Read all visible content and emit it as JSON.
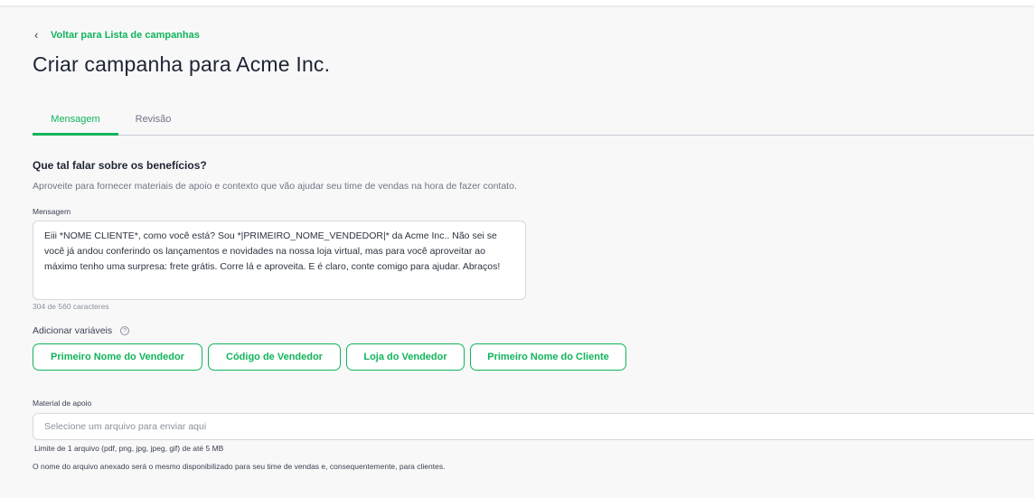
{
  "header": {
    "back_icon": "chevron-left-icon",
    "back_label": "Voltar para Lista de campanhas",
    "title": "Criar campanha para Acme Inc."
  },
  "tabs": [
    {
      "label": "Mensagem",
      "active": true
    },
    {
      "label": "Revisão",
      "active": false
    }
  ],
  "section": {
    "title": "Que tal falar sobre os benefícios?",
    "subtitle": "Aproveite para fornecer materiais de apoio e contexto que vão ajudar seu time de vendas na hora de fazer contato."
  },
  "message": {
    "label": "Mensagem",
    "value": "Eiii *NOME CLIENTE*, como você está? Sou *|PRIMEIRO_NOME_VENDEDOR|* da Acme Inc.. Não sei se você já andou conferindo os lançamentos e novidades na nossa loja virtual, mas para você aproveitar ao máximo tenho uma surpresa: frete grátis. Corre lá e aproveita. E é claro, conte comigo para ajudar. Abraços!",
    "counter": "304 de 560 caracteres"
  },
  "variables": {
    "label": "Adicionar variáveis",
    "help_icon": "question-circle-icon",
    "help_glyph": "?",
    "chips": [
      "Primeiro Nome do Vendedor",
      "Código de Vendedor",
      "Loja do Vendedor",
      "Primeiro Nome do Cliente"
    ]
  },
  "support_material": {
    "label": "Material de apoio",
    "placeholder": "Selecione um arquivo para enviar aqui",
    "limit_hint": "Limite de 1 arquivo (pdf, png, jpg, jpeg, gif) de até 5 MB",
    "note": "O nome do arquivo anexado será o mesmo disponibilizado para seu time de vendas e, consequentemente, para clientes."
  },
  "colors": {
    "accent": "#10b45a",
    "text": "#1d2433",
    "muted": "#6f7582",
    "background": "#f8f8f9"
  }
}
